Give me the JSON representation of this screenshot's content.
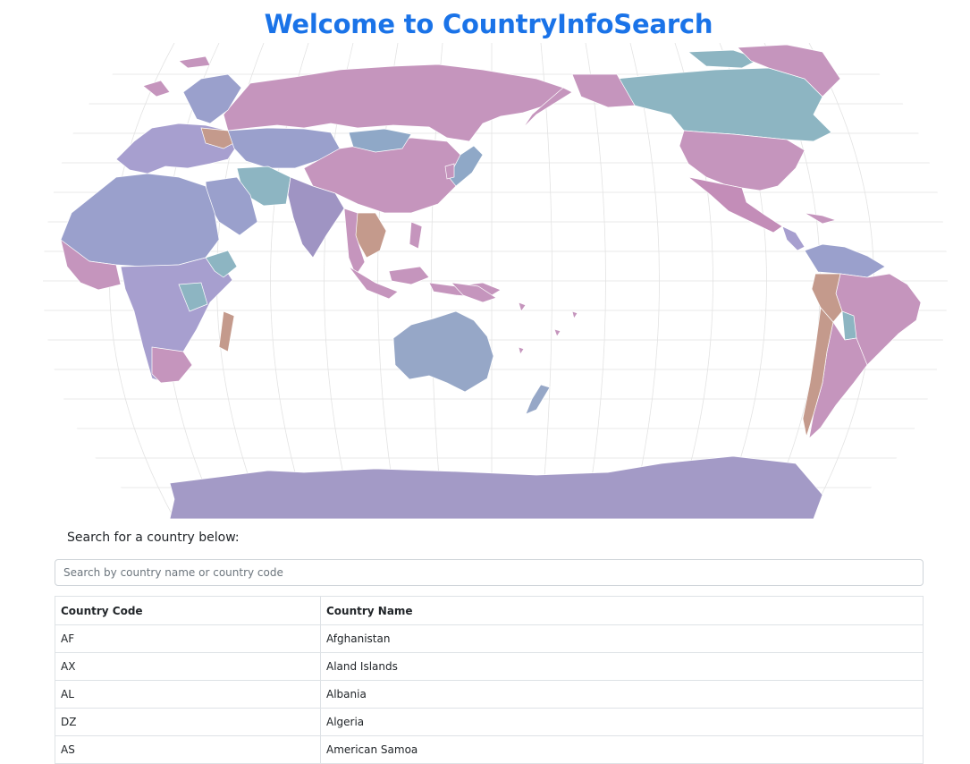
{
  "header": {
    "title": "Welcome to CountryInfoSearch"
  },
  "search": {
    "label": "Search for a country below:",
    "placeholder": "Search by country name or country code",
    "value": ""
  },
  "table": {
    "headers": {
      "code": "Country Code",
      "name": "Country Name"
    },
    "rows": [
      {
        "code": "AF",
        "name": "Afghanistan"
      },
      {
        "code": "AX",
        "name": "Aland Islands"
      },
      {
        "code": "AL",
        "name": "Albania"
      },
      {
        "code": "DZ",
        "name": "Algeria"
      },
      {
        "code": "AS",
        "name": "American Samoa"
      }
    ]
  },
  "map": {
    "projection": "pacific-centered world map with graticule",
    "colors": {
      "pink": "#c38db8",
      "purple": "#9f94c3",
      "blue": "#8fa8c7",
      "teal": "#8db5c2",
      "tan": "#c49a8c",
      "title": "#1a73e8"
    }
  }
}
